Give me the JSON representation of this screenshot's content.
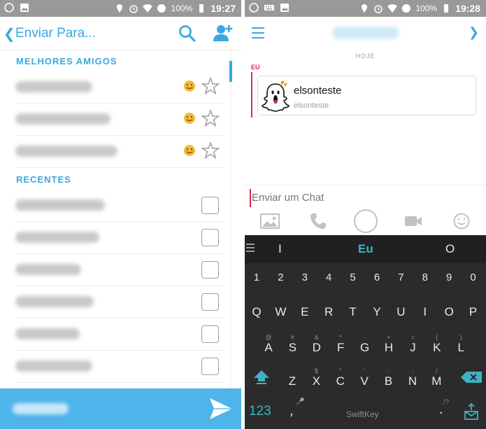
{
  "left": {
    "status": {
      "time": "19:27",
      "battery": "100%"
    },
    "header": {
      "back_icon": "chevron-left-icon",
      "title": "Enviar Para..."
    },
    "sections": {
      "best_friends": "MELHORES AMIGOS",
      "recent": "RECENTES"
    },
    "best_friends_count": 3,
    "recent_count": 6
  },
  "right": {
    "status": {
      "time": "19:28",
      "battery": "100%"
    },
    "date_label": "HOJE",
    "sender_label": "EU",
    "card": {
      "name": "elsonteste",
      "username": "elsonteste"
    },
    "chat_placeholder": "Enviar um Chat",
    "keyboard": {
      "suggestions": [
        "I",
        "Eu",
        "O"
      ],
      "row_numbers": [
        "1",
        "2",
        "3",
        "4",
        "5",
        "6",
        "7",
        "8",
        "9",
        "0"
      ],
      "row1": [
        "Q",
        "W",
        "E",
        "R",
        "T",
        "Y",
        "U",
        "I",
        "O",
        "P"
      ],
      "row1_sub": [
        "",
        "",
        "",
        "",
        "",
        "",
        "",
        "",
        "",
        ""
      ],
      "row2": [
        "A",
        "S",
        "D",
        "F",
        "G",
        "H",
        "J",
        "K",
        "L"
      ],
      "row2_sub": [
        "@",
        "#",
        "&",
        "*",
        "-",
        "+",
        "=",
        "(",
        ")"
      ],
      "row3": [
        "Z",
        "X",
        "C",
        "V",
        "B",
        "N",
        "M"
      ],
      "row3_sub": [
        "",
        "$",
        "\"",
        "'",
        ":",
        ";",
        "/"
      ],
      "mode_key": "123",
      "comma": ",",
      "period": ".",
      "punct_hint": ",!?",
      "brand": "SwiftKey"
    }
  },
  "colors": {
    "accent": "#3aa8df",
    "sender": "#e0284e",
    "keyboard_bg": "#2b2b2b",
    "keyboard_accent": "#3fb2c2"
  }
}
